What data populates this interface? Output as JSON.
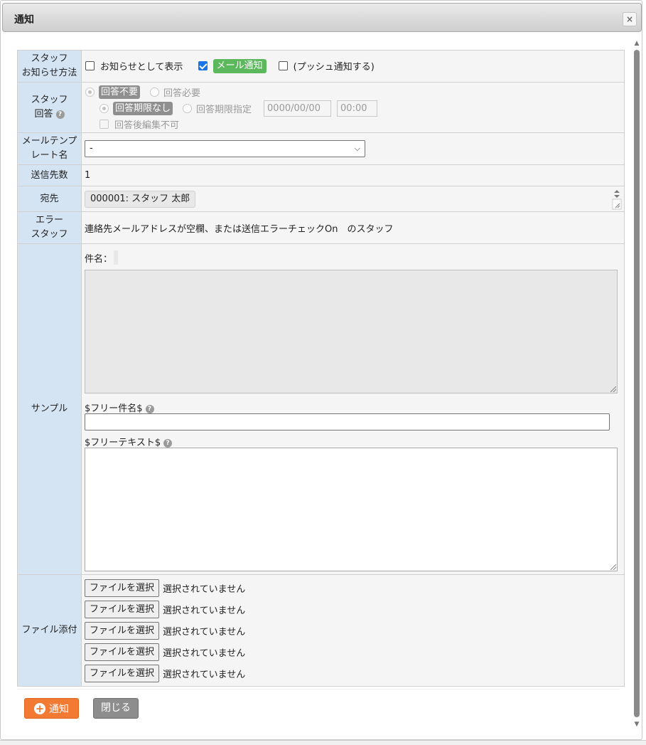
{
  "dialog": {
    "title": "通知",
    "close_icon": "×"
  },
  "form": {
    "method": {
      "label_line1": "スタッフ",
      "label_line2": "お知らせ方法",
      "show_as_notice": {
        "label": "お知らせとして表示",
        "checked": false
      },
      "mail_notify": {
        "label": "メール通知",
        "checked": true
      },
      "push_notify": {
        "label": "(プッシュ通知する)",
        "checked": false
      }
    },
    "reply": {
      "label_line1": "スタッフ",
      "label_line2": "回答",
      "no_reply": "回答不要",
      "reply_required": "回答必要",
      "no_deadline": "回答期限なし",
      "set_deadline": "回答期限指定",
      "date_placeholder": "0000/00/00",
      "time_placeholder": "00:00",
      "no_edit_after": "回答後編集不可"
    },
    "template": {
      "label_line1": "メールテンプ",
      "label_line2": "レート名",
      "selected": "-"
    },
    "recipient_count": {
      "label": "送信先数",
      "value": "1"
    },
    "recipient": {
      "label": "宛先",
      "chip": "000001: スタッフ 太郎"
    },
    "error_staff": {
      "label_line1": "エラー",
      "label_line2": "スタッフ",
      "text": "連絡先メールアドレスが空欄、または送信エラーチェックOn　のスタッフ"
    },
    "sample": {
      "label": "サンプル",
      "subject_label": "件名：",
      "free_subject_label": "$フリー件名$",
      "free_text_label": "$フリーテキスト$"
    },
    "attachments": {
      "label": "ファイル添付",
      "button_label": "ファイルを選択",
      "status": "選択されていません",
      "rows": [
        1,
        2,
        3,
        4,
        5
      ]
    }
  },
  "footer": {
    "notify_button": "通知",
    "close_button": "閉じる"
  },
  "colors": {
    "header_cell": "#d5e4f3",
    "notify_button": "#f37a33",
    "mail_badge": "#5cb85c",
    "close_button": "#8d8d8d"
  }
}
